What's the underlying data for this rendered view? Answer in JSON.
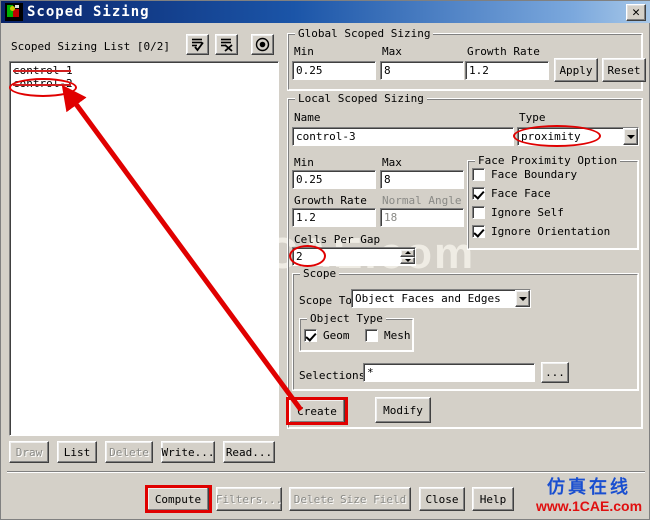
{
  "window": {
    "title": "Scoped Sizing",
    "close_label": "✕",
    "app_icon": "application-icon"
  },
  "left_panel": {
    "list_label": "Scoped Sizing List  [0/2]",
    "toolbar": [
      {
        "name": "select-all-icon",
        "glyph": "check"
      },
      {
        "name": "deselect-all-icon",
        "glyph": "x"
      },
      {
        "name": "select-filter-icon",
        "glyph": "dot"
      }
    ],
    "items": [
      {
        "label": "control-1"
      },
      {
        "label": "control-2"
      }
    ],
    "buttons": [
      {
        "label": "Draw",
        "enabled": false
      },
      {
        "label": "List",
        "enabled": true
      },
      {
        "label": "Delete",
        "enabled": false
      },
      {
        "label": "Write...",
        "enabled": true
      },
      {
        "label": "Read...",
        "enabled": true
      }
    ]
  },
  "global": {
    "title": "Global Scoped Sizing",
    "min_label": "Min",
    "min_value": "0.25",
    "max_label": "Max",
    "max_value": "8",
    "growth_label": "Growth Rate",
    "growth_value": "1.2",
    "apply_label": "Apply",
    "reset_label": "Reset"
  },
  "local": {
    "title": "Local Scoped Sizing",
    "name_label": "Name",
    "name_value": "control-3",
    "type_label": "Type",
    "type_value": "proximity",
    "min_label": "Min",
    "min_value": "0.25",
    "max_label": "Max",
    "max_value": "8",
    "growth_label": "Growth Rate",
    "growth_value": "1.2",
    "normal_angle_label": "Normal Angle",
    "normal_angle_value": "18",
    "cells_per_gap_label": "Cells Per Gap",
    "cells_per_gap_value": "2",
    "proximity": {
      "title": "Face Proximity Option",
      "options": [
        {
          "label": "Face Boundary",
          "checked": false
        },
        {
          "label": "Face Face",
          "checked": true
        },
        {
          "label": "Ignore Self",
          "checked": false
        },
        {
          "label": "Ignore Orientation",
          "checked": true
        }
      ]
    },
    "scope": {
      "title": "Scope",
      "scope_to_label": "Scope To",
      "scope_to_value": "Object Faces and Edges",
      "object_type_title": "Object Type",
      "object_types": [
        {
          "label": "Geom",
          "checked": true
        },
        {
          "label": "Mesh",
          "checked": false
        }
      ],
      "selections_label": "Selections",
      "selections_value": "*",
      "browse_label": "..."
    },
    "create_label": "Create",
    "modify_label": "Modify"
  },
  "footer": {
    "buttons": [
      {
        "label": "Compute",
        "enabled": true
      },
      {
        "label": "Filters...",
        "enabled": false
      },
      {
        "label": "Delete Size Field",
        "enabled": false
      },
      {
        "label": "Close",
        "enabled": true
      },
      {
        "label": "Help",
        "enabled": true
      }
    ]
  },
  "watermark": {
    "background_text": "1CAE.com",
    "logo_cn": "仿真在线",
    "logo_url": "www.1CAE.com"
  },
  "annotations": {
    "accent_color": "#e00000",
    "highlighted": [
      "list-item-control-2",
      "type-combo",
      "cells-per-gap-field",
      "create-button"
    ]
  }
}
